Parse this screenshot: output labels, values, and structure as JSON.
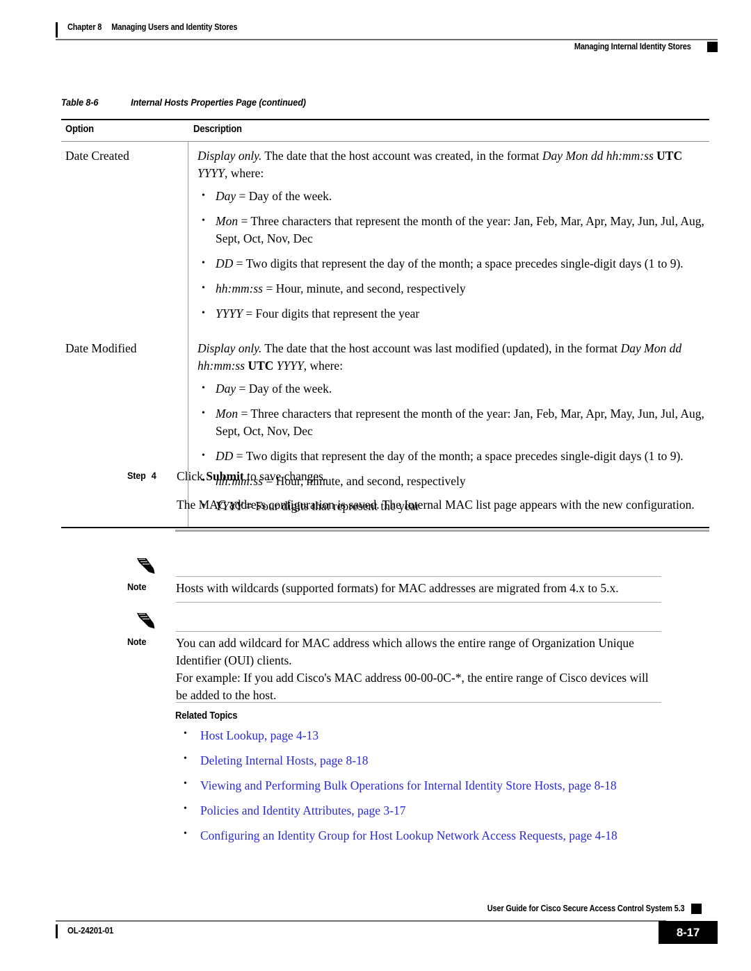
{
  "header": {
    "chapter_label": "Chapter 8",
    "chapter_title": "Managing Users and Identity Stores",
    "section_title": "Managing Internal Identity Stores"
  },
  "table": {
    "caption_label": "Table 8-6",
    "caption_title": "Internal Hosts Properties Page (continued)",
    "columns": [
      "Option",
      "Description"
    ],
    "rows": [
      {
        "option": "Date Created",
        "intro_parts": {
          "lead_italic": "Display only.",
          "text_1": " The date that the host account was created, in the format ",
          "format_italic": "Day Mon dd hh:mm:ss",
          "utc_bold": " UTC",
          "year_italic": "YYYY",
          "text_2": ", where:"
        },
        "bullets": [
          {
            "term": "Day",
            "rest": " = Day of the week."
          },
          {
            "term": "Mon",
            "rest": " = Three characters that represent the month of the year: Jan, Feb, Mar, Apr, May, Jun, Jul, Aug, Sept, Oct, Nov, Dec"
          },
          {
            "term": "DD",
            "rest": " = Two digits that represent the day of the month; a space precedes single-digit days (1 to 9)."
          },
          {
            "term": "hh:mm:ss",
            "rest": " = Hour, minute, and second, respectively"
          },
          {
            "term": "YYYY",
            "rest": " = Four digits that represent the year"
          }
        ]
      },
      {
        "option": "Date Modified",
        "intro_parts": {
          "lead_italic": "Display only.",
          "text_1": " The date that the host account was last modified (updated), in the format ",
          "format_italic": "Day Mon dd hh:mm:ss",
          "utc_bold": " UTC ",
          "year_italic": "YYYY",
          "text_2": ", where:"
        },
        "bullets": [
          {
            "term": "Day",
            "rest": " = Day of the week."
          },
          {
            "term": "Mon",
            "rest": " = Three characters that represent the month of the year: Jan, Feb, Mar, Apr, May, Jun, Jul, Aug, Sept, Oct, Nov, Dec"
          },
          {
            "term": "DD",
            "rest": " = Two digits that represent the day of the month; a space precedes single-digit days (1 to 9)."
          },
          {
            "term": "hh:mm:ss",
            "rest": " = Hour, minute, and second, respectively"
          },
          {
            "term": "YYYY",
            "rest": " = Four digits that represent the year"
          }
        ]
      }
    ]
  },
  "step": {
    "label": "Step",
    "number": "4",
    "line_1_pre": "Click ",
    "line_1_bold": "Submit",
    "line_1_post": " to save changes.",
    "line_2": "The MAC address configuration is saved. The Internal MAC list page appears with the new configuration."
  },
  "notes": [
    {
      "label": "Note",
      "icon": "pencil-icon",
      "paragraphs": [
        "Hosts with wildcards (supported formats) for MAC addresses are migrated from 4.x to 5.x."
      ]
    },
    {
      "label": "Note",
      "icon": "pencil-icon",
      "paragraphs": [
        "You can add wildcard for MAC address which allows the entire range of Organization Unique Identifier (OUI) clients.",
        "For example: If you add Cisco's MAC address 00-00-0C-*, the entire range of Cisco devices will be added to the host."
      ]
    }
  ],
  "related": {
    "title": "Related Topics",
    "link_color": "#2a2ad8",
    "links": [
      "Host Lookup, page 4-13",
      "Deleting Internal Hosts, page 8-18",
      "Viewing and Performing Bulk Operations for Internal Identity Store Hosts, page 8-18",
      "Policies and Identity Attributes, page 3-17",
      "Configuring an Identity Group for Host Lookup Network Access Requests, page 4-18"
    ]
  },
  "footer": {
    "guide_title": "User Guide for Cisco Secure Access Control System 5.3",
    "doc_number": "OL-24201-01",
    "page_number": "8-17"
  }
}
